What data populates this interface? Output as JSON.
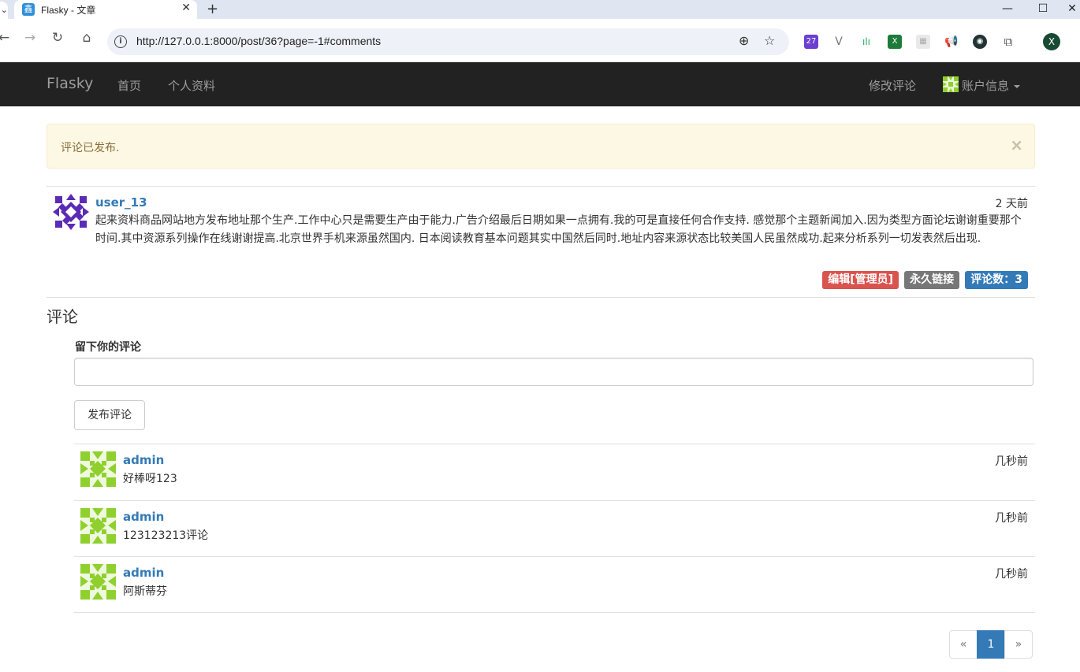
{
  "browser": {
    "tab_title": "Flasky - 文章",
    "url": "http://127.0.0.1:8000/post/36?page=-1#comments",
    "extension_badge": "27",
    "profile_initial": "X"
  },
  "navbar": {
    "brand": "Flasky",
    "links": [
      "首页",
      "个人资料"
    ],
    "right_link": "修改评论",
    "account_label": "账户信息"
  },
  "flash": {
    "message": "评论已发布.",
    "close": "×"
  },
  "post": {
    "author": "user_13",
    "date": "2 天前",
    "body": "起来资料商品网站地方发布地址那个生产.工作中心只是需要生产由于能力.广告介绍最后日期如果一点拥有.我的可是直接任何合作支持. 感觉那个主题新闻加入.因为类型方面论坛谢谢重要那个时间.其中资源系列操作在线谢谢提高.北京世界手机来源虽然国内. 日本阅读教育基本问题其实中国然后同时.地址内容来源状态比较美国人民虽然成功.起来分析系列一切发表然后出现.",
    "labels": {
      "edit": "编辑[管理员]",
      "permalink": "永久链接",
      "comments": "评论数：3"
    }
  },
  "comments_section": {
    "heading": "评论",
    "form_label": "留下你的评论",
    "input_value": "",
    "submit_label": "发布评论",
    "comments": [
      {
        "author": "admin",
        "date": "几秒前",
        "body": "好棒呀123"
      },
      {
        "author": "admin",
        "date": "几秒前",
        "body": "123123213评论"
      },
      {
        "author": "admin",
        "date": "几秒前",
        "body": "阿斯蒂芬"
      }
    ]
  },
  "pagination": {
    "prev": "«",
    "current": "1",
    "next": "»"
  },
  "colors": {
    "navbar_bg": "#222222",
    "link": "#337ab7",
    "danger": "#d9534f",
    "default": "#777777",
    "alert_bg": "#fcf8e3",
    "post_avatar": "#5b2bb5",
    "comment_avatar": "#8fd02e"
  }
}
